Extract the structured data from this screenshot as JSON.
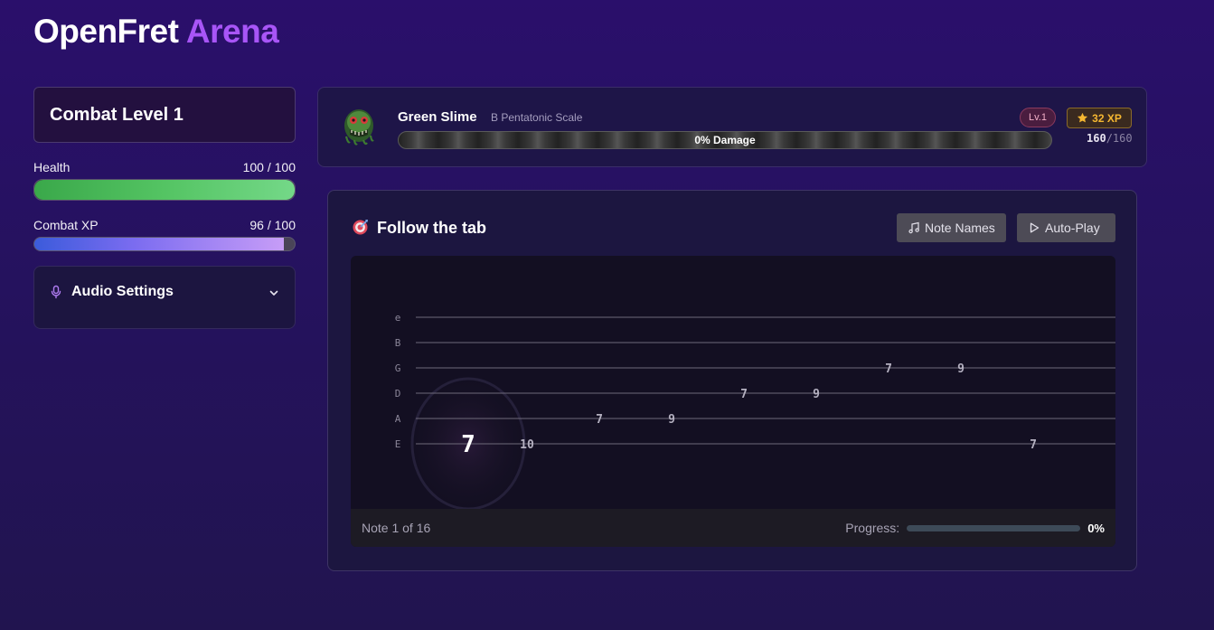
{
  "app": {
    "title_main": "OpenFret",
    "title_accent": "Arena"
  },
  "player": {
    "level_label": "Combat Level 1",
    "health_label": "Health",
    "health_value": "100 / 100",
    "health_fraction": 1.0,
    "xp_label": "Combat XP",
    "xp_value": "96 / 100",
    "xp_fraction": 0.96
  },
  "audio": {
    "title": "Audio Settings",
    "icon": "microphone-icon",
    "expand_icon": "chevron-down-icon"
  },
  "enemy": {
    "name": "Green Slime",
    "scale": "B Pentatonic Scale",
    "level_badge": "Lv.1",
    "xp_reward": "32 XP",
    "damage_text": "0% Damage",
    "damage_fraction": 0,
    "hp_current": "160",
    "hp_max": "/160"
  },
  "tab": {
    "title": "Follow the tab",
    "icon": "target-icon",
    "note_names_label": "Note Names",
    "autoplay_label": "Auto-Play",
    "strings": [
      "e",
      "B",
      "G",
      "D",
      "A",
      "E"
    ],
    "notes": [
      {
        "string": "E",
        "fret": "7",
        "active": true
      },
      {
        "string": "E",
        "fret": "10"
      },
      {
        "string": "A",
        "fret": "7"
      },
      {
        "string": "A",
        "fret": "9"
      },
      {
        "string": "D",
        "fret": "7"
      },
      {
        "string": "D",
        "fret": "9"
      },
      {
        "string": "G",
        "fret": "7"
      },
      {
        "string": "G",
        "fret": "9"
      },
      {
        "string": "E",
        "fret": "7"
      }
    ],
    "note_counter": "Note 1 of 16",
    "progress_label": "Progress:",
    "progress_value": "0%",
    "progress_fraction": 0
  },
  "colors": {
    "accent": "#a855f7",
    "health": "#54c463",
    "xp_gold": "#f5b731"
  }
}
